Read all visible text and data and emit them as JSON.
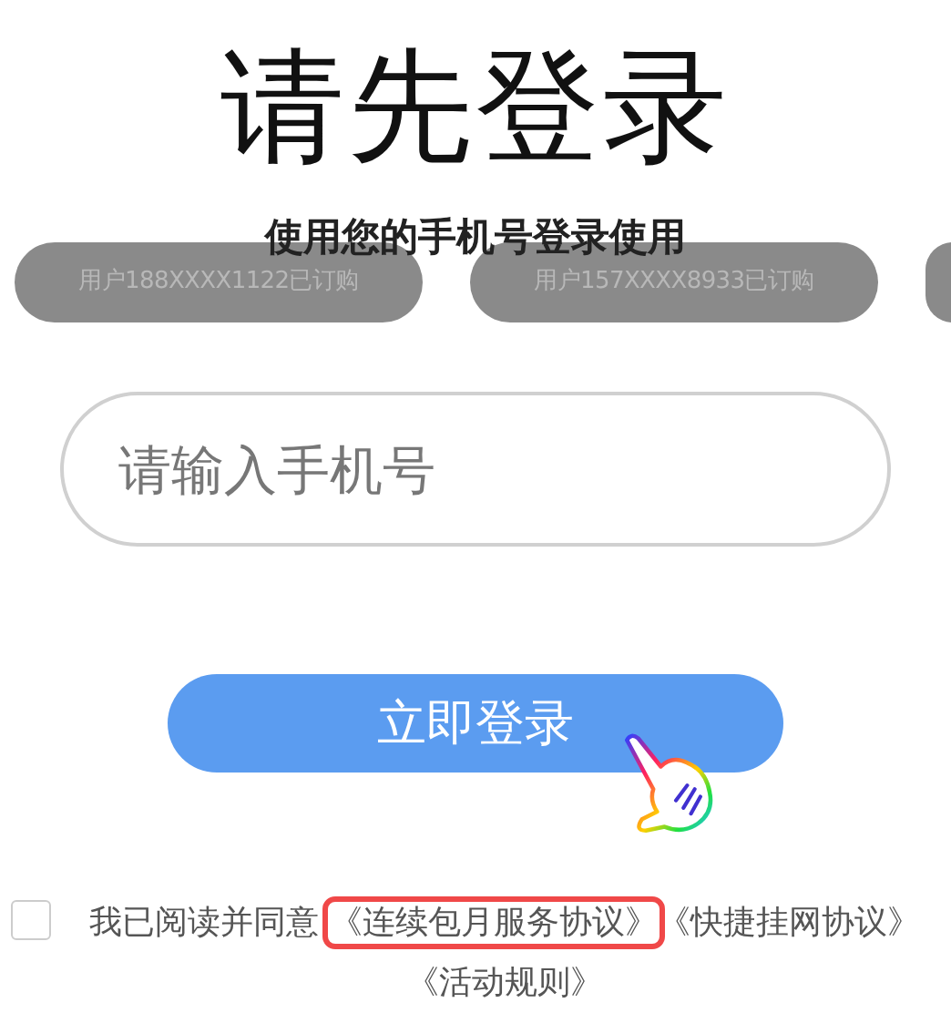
{
  "title": "请先登录",
  "subtitle": "使用您的手机号登录使用",
  "toasts": [
    {
      "kind": "full",
      "text": "用户188XXXX1122已订购"
    },
    {
      "kind": "full",
      "text": "用户157XXXX8933已订购"
    },
    {
      "kind": "cut"
    }
  ],
  "phone_field": {
    "placeholder": "请输入手机号"
  },
  "login_button": "立即登录",
  "agreement": {
    "checked": false,
    "prefix": "我已阅读并同意",
    "links": [
      {
        "text": "《连续包月服务协议》",
        "highlighted": true
      },
      {
        "text": "《快捷挂网协议》",
        "highlighted": false
      },
      {
        "text": "《活动规则》",
        "highlighted": false
      }
    ]
  }
}
